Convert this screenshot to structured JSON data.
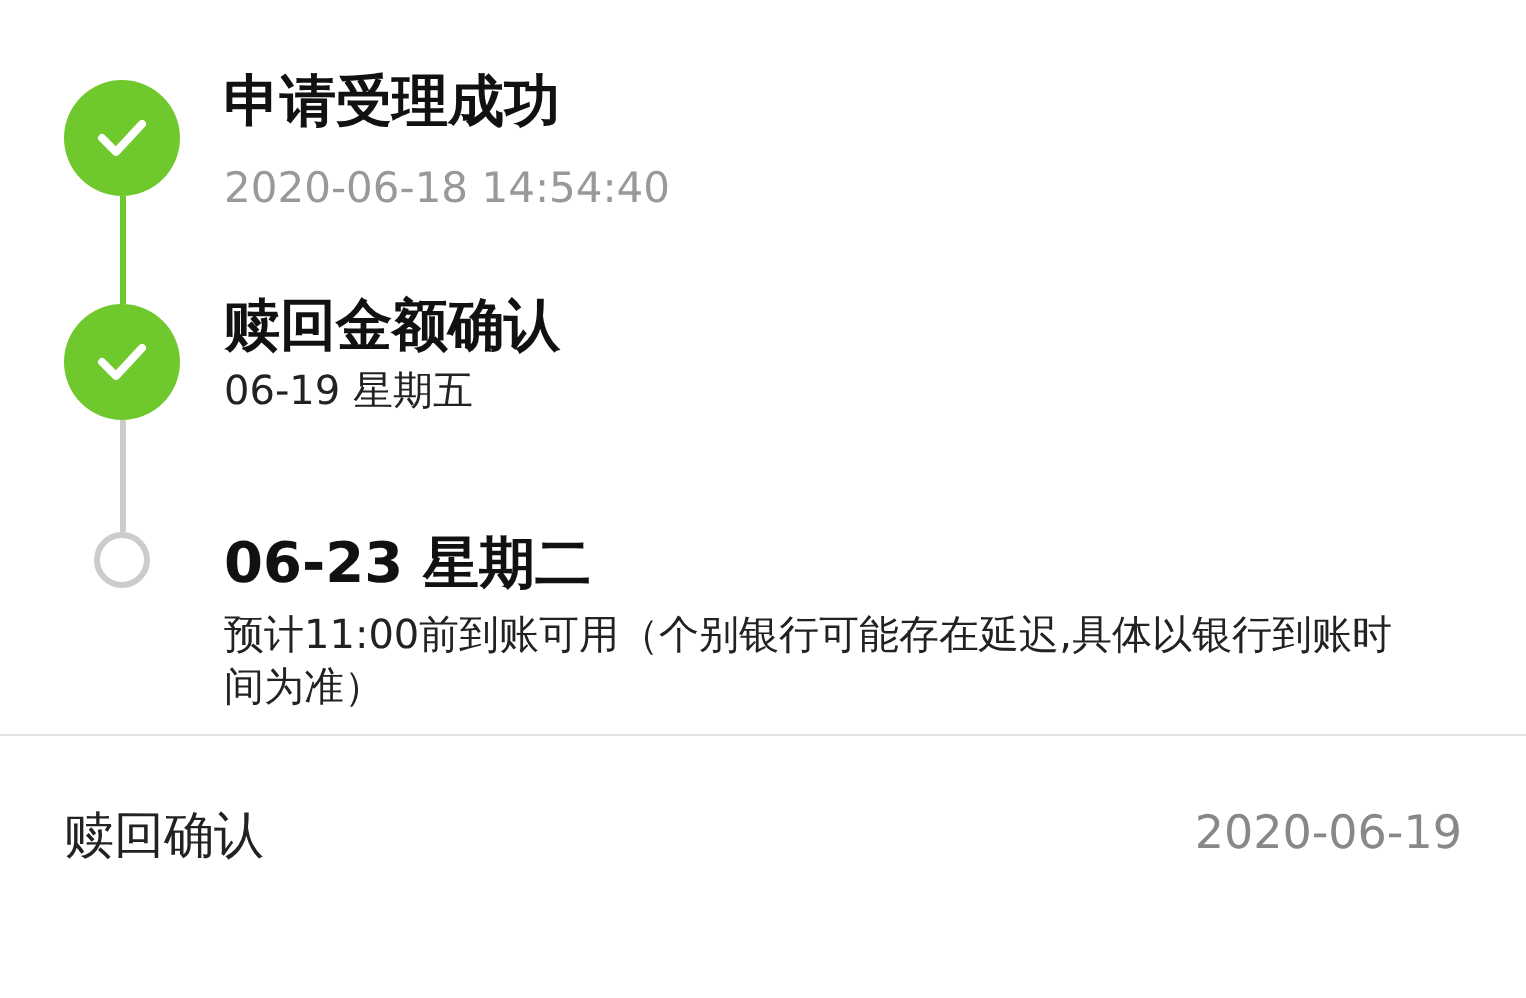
{
  "steps": [
    {
      "completed": true,
      "title": "申请受理成功",
      "time": "2020-06-18 14:54:40"
    },
    {
      "completed": true,
      "title": "赎回金额确认",
      "date": "06-19 星期五"
    },
    {
      "completed": false,
      "title": "06-23 星期二",
      "note": "预计11:00前到账可用（个别银行可能存在延迟,具体以银行到账时间为准）"
    }
  ],
  "summary": {
    "label": "赎回确认",
    "value": "2020-06-19"
  }
}
